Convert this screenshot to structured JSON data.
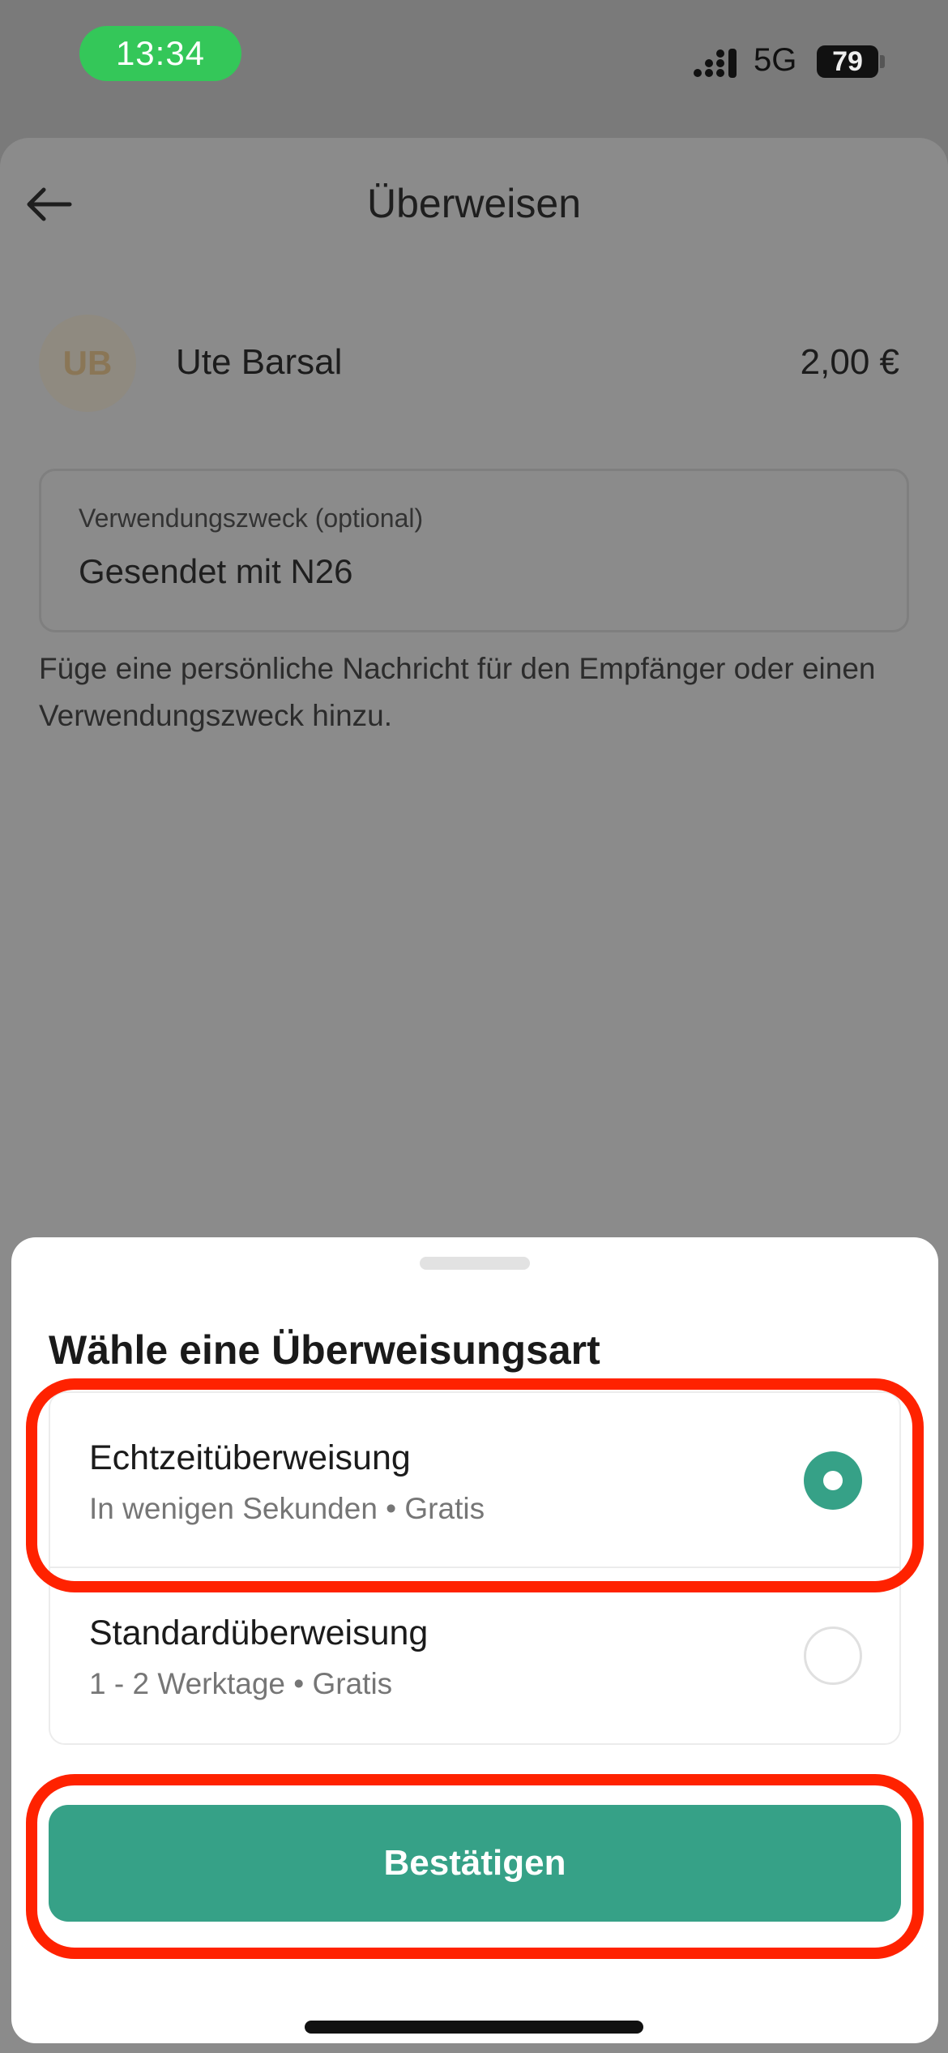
{
  "status_bar": {
    "time": "13:34",
    "network": "5G",
    "battery": "79",
    "time_pill_color": "#34c759"
  },
  "header": {
    "title": "Überweisen",
    "back_icon": "arrow-left-icon"
  },
  "recipient": {
    "initials": "UB",
    "name": "Ute Barsal",
    "amount": "2,00 €"
  },
  "reference": {
    "label": "Verwendungszweck (optional)",
    "value": "Gesendet mit N26",
    "helper": "Füge eine persönliche Nachricht für den Empfänger oder einen Verwendungszweck hinzu."
  },
  "sheet": {
    "title": "Wähle eine Überweisungsart",
    "options": [
      {
        "title": "Echtzeitüberweisung",
        "subtitle": "In wenigen Sekunden • Gratis",
        "selected": true
      },
      {
        "title": "Standardüberweisung",
        "subtitle": "1 - 2 Werktage • Gratis",
        "selected": false
      }
    ],
    "confirm_label": "Bestätigen",
    "accent_color": "#36a187"
  },
  "annotations": {
    "highlight_color": "#ff2200"
  }
}
